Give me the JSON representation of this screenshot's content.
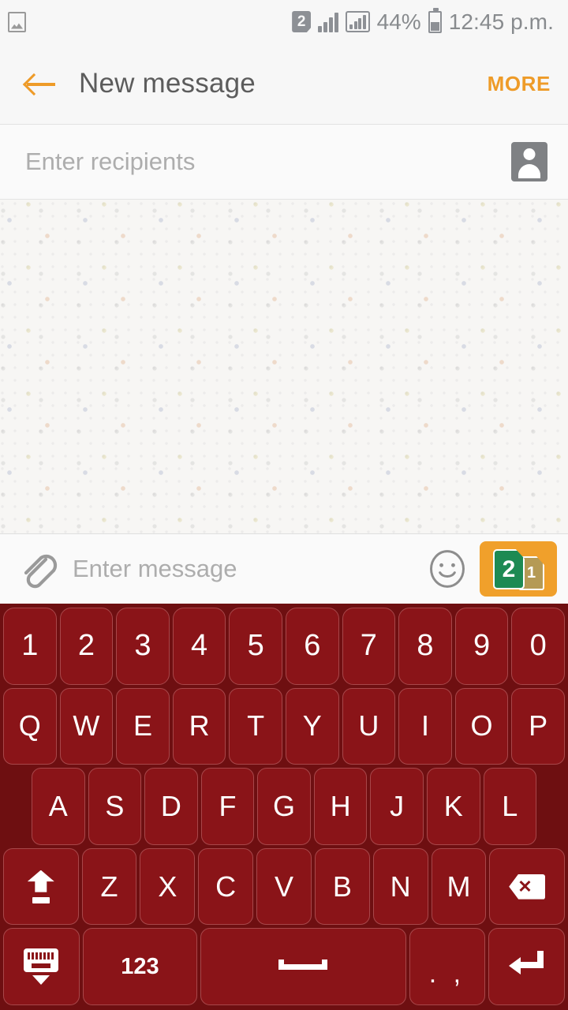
{
  "statusbar": {
    "photo_icon": "image-saved-icon",
    "sim_badge": "2",
    "signal_icon_1": "signal-bars-icon",
    "signal_icon_2": "signal-bars-boxed-icon",
    "battery_percent": "44%",
    "battery_icon": "battery-icon",
    "time": "12:45 p.m."
  },
  "appbar": {
    "back_icon": "back-arrow-icon",
    "title": "New message",
    "more_label": "MORE",
    "accent_color": "#ee9b28"
  },
  "recipients": {
    "placeholder": "Enter recipients",
    "contact_icon": "contact-picker-icon"
  },
  "compose": {
    "attach_icon": "paperclip-icon",
    "placeholder": "Enter message",
    "emoji_icon": "smiley-icon",
    "send": {
      "label_front": "2",
      "label_back": "1",
      "background_color": "#f0a02b",
      "sim_front_color": "#1d8a53",
      "sim_back_color": "#b59a55"
    }
  },
  "keyboard": {
    "background_color": "#6e0f11",
    "key_color": "#8a1418",
    "key_border_color": "#a8474a",
    "rows": [
      {
        "name": "number-row",
        "keys": [
          {
            "label": "1",
            "name": "key-1"
          },
          {
            "label": "2",
            "name": "key-2"
          },
          {
            "label": "3",
            "name": "key-3"
          },
          {
            "label": "4",
            "name": "key-4"
          },
          {
            "label": "5",
            "name": "key-5"
          },
          {
            "label": "6",
            "name": "key-6"
          },
          {
            "label": "7",
            "name": "key-7"
          },
          {
            "label": "8",
            "name": "key-8"
          },
          {
            "label": "9",
            "name": "key-9"
          },
          {
            "label": "0",
            "name": "key-0"
          }
        ]
      },
      {
        "name": "qwerty-row",
        "keys": [
          {
            "label": "Q",
            "name": "key-q"
          },
          {
            "label": "W",
            "name": "key-w"
          },
          {
            "label": "E",
            "name": "key-e"
          },
          {
            "label": "R",
            "name": "key-r"
          },
          {
            "label": "T",
            "name": "key-t"
          },
          {
            "label": "Y",
            "name": "key-y"
          },
          {
            "label": "U",
            "name": "key-u"
          },
          {
            "label": "I",
            "name": "key-i"
          },
          {
            "label": "O",
            "name": "key-o"
          },
          {
            "label": "P",
            "name": "key-p"
          }
        ]
      },
      {
        "name": "asdf-row",
        "keys": [
          {
            "label": "A",
            "name": "key-a"
          },
          {
            "label": "S",
            "name": "key-s"
          },
          {
            "label": "D",
            "name": "key-d"
          },
          {
            "label": "F",
            "name": "key-f"
          },
          {
            "label": "G",
            "name": "key-g"
          },
          {
            "label": "H",
            "name": "key-h"
          },
          {
            "label": "J",
            "name": "key-j"
          },
          {
            "label": "K",
            "name": "key-k"
          },
          {
            "label": "L",
            "name": "key-l"
          }
        ]
      },
      {
        "name": "zxcv-row",
        "keys": [
          {
            "label": "",
            "name": "key-shift",
            "icon": "shift-icon"
          },
          {
            "label": "Z",
            "name": "key-z"
          },
          {
            "label": "X",
            "name": "key-x"
          },
          {
            "label": "C",
            "name": "key-c"
          },
          {
            "label": "V",
            "name": "key-v"
          },
          {
            "label": "B",
            "name": "key-b"
          },
          {
            "label": "N",
            "name": "key-n"
          },
          {
            "label": "M",
            "name": "key-m"
          },
          {
            "label": "",
            "name": "key-backspace",
            "icon": "backspace-icon"
          }
        ]
      },
      {
        "name": "bottom-row",
        "keys": [
          {
            "label": "",
            "name": "key-hide-keyboard",
            "icon": "keyboard-hide-icon"
          },
          {
            "label": "123",
            "name": "key-numeric-mode"
          },
          {
            "label": "",
            "name": "key-space",
            "icon": "space-icon"
          },
          {
            "label": ". ,",
            "name": "key-period-comma"
          },
          {
            "label": "",
            "name": "key-enter",
            "icon": "enter-icon"
          }
        ]
      }
    ]
  }
}
